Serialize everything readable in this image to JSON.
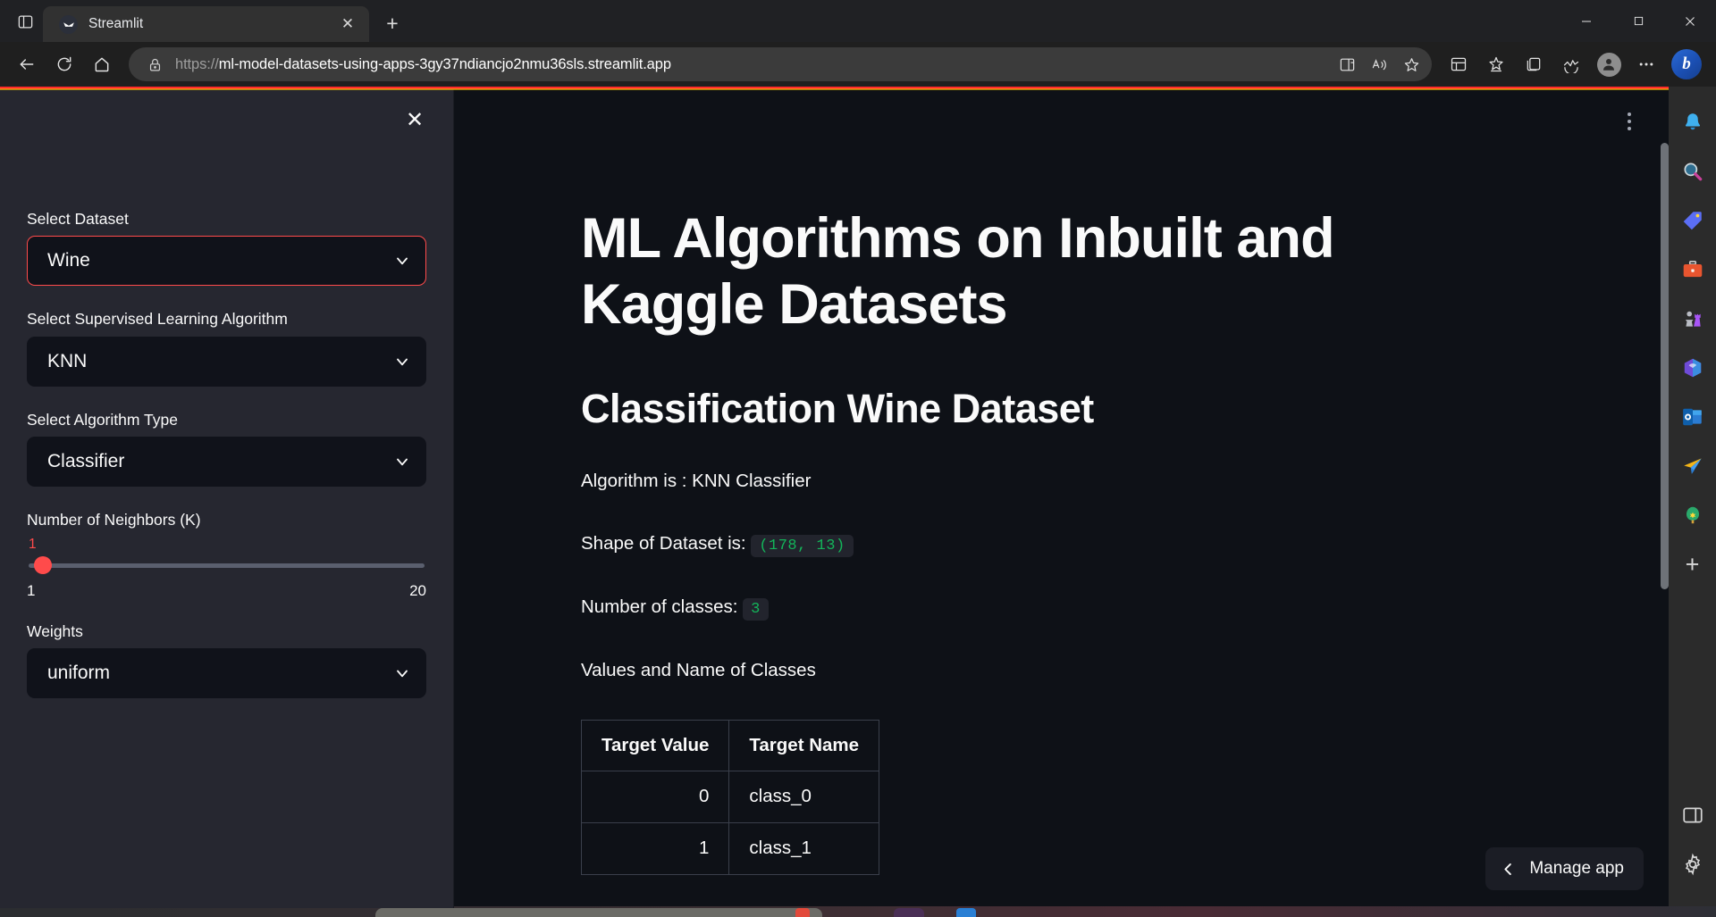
{
  "browser": {
    "tab": {
      "title": "Streamlit",
      "favicon": "streamlit-crown-icon",
      "close_label": "✕"
    },
    "new_tab_label": "+",
    "tab_list_icon": "tab-list-icon",
    "window_controls": {
      "minimize": "—",
      "maximize": "☐",
      "close": "✕"
    },
    "nav": {
      "back": "←",
      "refresh": "⟳",
      "home": "⌂"
    },
    "omnibox": {
      "lock_icon": "lock-icon",
      "scheme": "https://",
      "host": "ml-model-datasets-using-apps-3gy37ndiancjo2nmu36sls.streamlit.app",
      "full_url": "https://ml-model-datasets-using-apps-3gy37ndiancjo2nmu36sls.streamlit.app",
      "actions": [
        "split-screen-icon",
        "read-aloud-icon",
        "favorite-star-icon"
      ]
    },
    "toolbar_right": [
      "browser-essentials-icon",
      "favorites-icon",
      "collections-icon",
      "performance-icon",
      "profile-avatar",
      "settings-more-icon"
    ],
    "copilot_label": "b"
  },
  "edge_sidebar": {
    "items": [
      {
        "name": "notifications-icon",
        "label": "Notifications"
      },
      {
        "name": "search-icon",
        "label": "Search"
      },
      {
        "name": "shopping-tag-icon",
        "label": "Shopping"
      },
      {
        "name": "tools-briefcase-icon",
        "label": "Tools"
      },
      {
        "name": "games-chess-icon",
        "label": "Games"
      },
      {
        "name": "microsoft-365-icon",
        "label": "Microsoft 365"
      },
      {
        "name": "outlook-icon",
        "label": "Outlook"
      },
      {
        "name": "paper-plane-icon",
        "label": "Send"
      },
      {
        "name": "drop-tree-icon",
        "label": "Drop"
      }
    ],
    "add_label": "+",
    "bottom": [
      {
        "name": "sidebar-toggle-icon",
        "label": "Customize sidebar"
      },
      {
        "name": "sidebar-settings-icon",
        "label": "Settings"
      }
    ]
  },
  "app": {
    "sidebar": {
      "close_label": "✕",
      "controls": [
        {
          "label": "Select Dataset",
          "value": "Wine",
          "focused": true
        },
        {
          "label": "Select Supervised Learning Algorithm",
          "value": "KNN",
          "focused": false
        },
        {
          "label": "Select Algorithm Type",
          "value": "Classifier",
          "focused": false
        }
      ],
      "slider": {
        "label": "Number of Neighbors (K)",
        "value": "1",
        "min": "1",
        "max": "20",
        "accent_color": "#ff4b4b"
      },
      "weights": {
        "label": "Weights",
        "value": "uniform"
      }
    },
    "main": {
      "title": "ML Algorithms on Inbuilt and Kaggle Datasets",
      "subtitle": "Classification Wine Dataset",
      "algorithm_line": "Algorithm is : KNN Classifier",
      "shape_label": "Shape of Dataset is:",
      "shape_value": "(178, 13)",
      "classes_label": "Number of classes:",
      "classes_value": "3",
      "table_caption": "Values and Name of Classes",
      "table": {
        "headers": [
          "Target Value",
          "Target Name"
        ],
        "rows": [
          {
            "value": "0",
            "name": "class_0"
          },
          {
            "value": "1",
            "name": "class_1"
          }
        ]
      },
      "manage_app": {
        "label": "Manage app",
        "chevron": "chevron-left-icon"
      },
      "menu_icon": "kebab-menu-icon"
    }
  },
  "status": {
    "zoom": ""
  }
}
